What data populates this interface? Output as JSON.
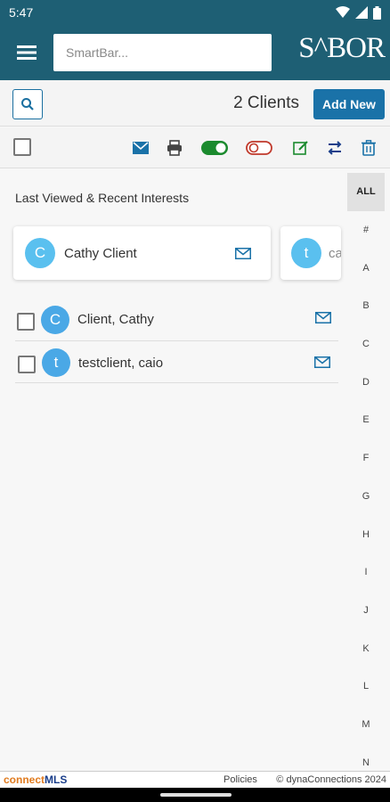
{
  "status": {
    "time": "5:47"
  },
  "appbar": {
    "search_placeholder": "SmartBar...",
    "logo_text": "S^BOR"
  },
  "header": {
    "client_count": "2 Clients",
    "add_new_label": "Add New"
  },
  "recent": {
    "title": "Last Viewed & Recent Interests",
    "cards": [
      {
        "initial": "C",
        "name": "Cathy Client"
      },
      {
        "initial": "t",
        "name": "ca"
      }
    ]
  },
  "clients": [
    {
      "initial": "C",
      "name": "Client, Cathy"
    },
    {
      "initial": "t",
      "name": "testclient, caio"
    }
  ],
  "alphabet": [
    "ALL",
    "#",
    "A",
    "B",
    "C",
    "D",
    "E",
    "F",
    "G",
    "H",
    "I",
    "J",
    "K",
    "L",
    "M",
    "N"
  ],
  "footer": {
    "brand_connect": "connect",
    "brand_mls": "MLS",
    "policies": "Policies",
    "copyright": "© dynaConnections 2024"
  },
  "colors": {
    "primary": "#1e5f74",
    "accent": "#1a72a8",
    "avatar": "#4aa8e6",
    "avatar_light": "#5ac0ef"
  }
}
